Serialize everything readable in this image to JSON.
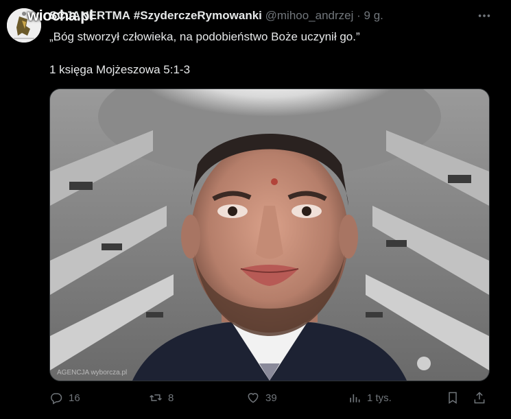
{
  "watermark": "wiocha.pl",
  "header": {
    "name": "SCJANERTMA",
    "tag": "#SzyderczeRymowanki",
    "handle": "@mihoo_andrzej",
    "dot": "·",
    "time": "9 g.",
    "more_icon": "more-horizontal-icon"
  },
  "tweet": {
    "line1": "„Bóg stworzył człowieka, na podobieństwo Boże uczynił go.”",
    "line2": "1 księga Mojżeszowa 5:1-3"
  },
  "media": {
    "credit": "AGENCJA wyborcza.pl"
  },
  "actions": {
    "reply": {
      "icon": "reply-icon",
      "count": "16"
    },
    "repost": {
      "icon": "repost-icon",
      "count": "8"
    },
    "like": {
      "icon": "like-icon",
      "count": "39"
    },
    "views": {
      "icon": "views-icon",
      "count": "1 tys."
    },
    "bookmark": {
      "icon": "bookmark-icon"
    },
    "share": {
      "icon": "share-icon"
    }
  },
  "colors": {
    "background": "#000000",
    "text": "#e7e9ea",
    "muted": "#71767b"
  }
}
